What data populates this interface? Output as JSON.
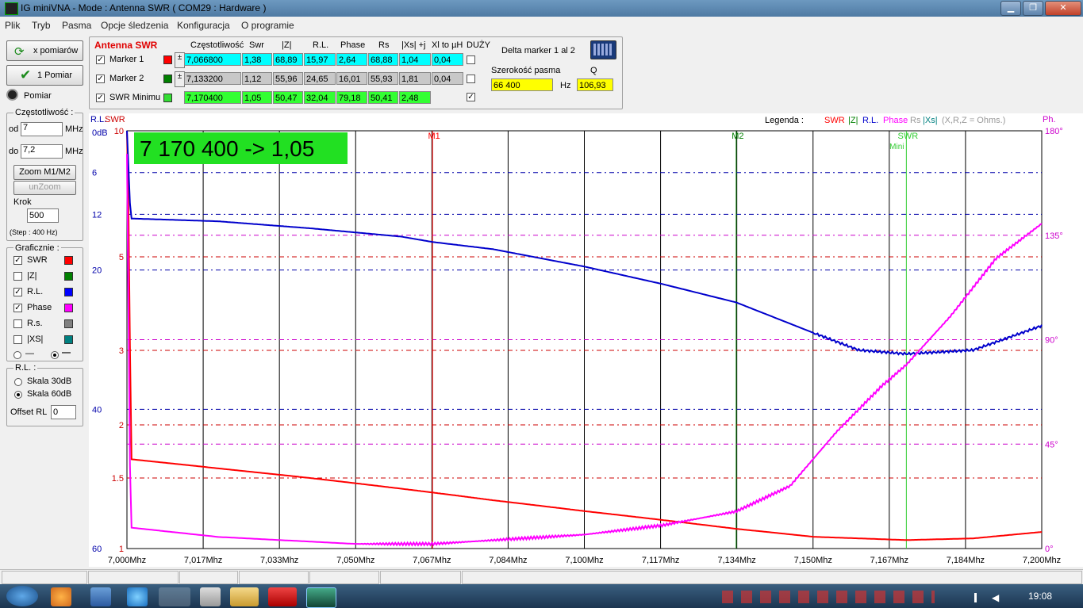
{
  "window": {
    "title": "IG miniVNA - Mode : Antenna SWR ( COM29 :  Hardware )",
    "minimize_glyph": "▁",
    "maximize_glyph": "❐",
    "close_glyph": "✕"
  },
  "menu": [
    "Plik",
    "Tryb",
    "Pasma",
    "Opcje śledzenia",
    "Konfiguracja",
    "O programie"
  ],
  "left": {
    "x_pomiarow": "x pomiarów",
    "one_pomiar": "1 Pomiar",
    "pomiar": "Pomiar",
    "freq_group": "Częstotliwość :",
    "od_label": "od",
    "od_value": "7",
    "do_label": "do",
    "do_value": "7,2",
    "mhz": "MHz",
    "zoom_btn": "Zoom M1/M2",
    "unzoom_btn": "unZoom",
    "krok_label": "Krok",
    "krok_value": "500",
    "step_note": "(Step : 400 Hz)",
    "graf_group": "Graficznie :",
    "graf_items": [
      {
        "label": "SWR",
        "checked": true,
        "color": "#ff0000"
      },
      {
        "label": "|Z|",
        "checked": false,
        "color": "#008000"
      },
      {
        "label": "R.L.",
        "checked": true,
        "color": "#0000ff"
      },
      {
        "label": "Phase",
        "checked": true,
        "color": "#ff00ff"
      },
      {
        "label": "R.s.",
        "checked": false,
        "color": "#808080"
      },
      {
        "label": "|XS|",
        "checked": false,
        "color": "#008080"
      }
    ],
    "rl_group": "R.L. :",
    "skala30": "Skala 30dB",
    "skala60": "Skala 60dB",
    "offset_label": "Offset RL",
    "offset_value": "0"
  },
  "markers": {
    "title": "Antenna SWR",
    "headers": [
      "Częstotliwość",
      "Swr",
      "|Z|",
      "R.L.",
      "Phase",
      "Rs",
      "|Xs| +j",
      "Xl to µH",
      "DUŻY"
    ],
    "rows": [
      {
        "label": "Marker 1",
        "color": "#ff0000",
        "values": [
          "7,066800",
          "1,38",
          "68,89",
          "15,97",
          "2,64",
          "68,88",
          "1,04",
          "0,04"
        ],
        "style": "cyan"
      },
      {
        "label": "Marker 2",
        "color": "#008000",
        "values": [
          "7,133200",
          "1,12",
          "55,96",
          "24,65",
          "16,01",
          "55,93",
          "1,81",
          "0,04"
        ],
        "style": "gray"
      },
      {
        "label": "SWR Minimu",
        "color": "#33dd33",
        "values": [
          "7,170400",
          "1,05",
          "50,47",
          "32,04",
          "79,18",
          "50,41",
          "2,48"
        ],
        "style": "green"
      }
    ],
    "pm": "±",
    "delta_label": "Delta marker 1 al 2",
    "bandwidth_label": "Szerokość pasma",
    "bandwidth_value": "66 400",
    "hz": "Hz",
    "q_label": "Q",
    "q_value": "106,93",
    "duzy_check": "✓"
  },
  "chart_data": {
    "type": "line",
    "readout": "7 170 400 -> 1,05",
    "left_header_rl": "R.L.",
    "left_header_swr": "SWR",
    "right_header": "Ph.",
    "legend_label": "Legenda :",
    "legend": [
      {
        "name": "SWR",
        "color": "#ff0000"
      },
      {
        "name": "|Z|",
        "color": "#008000"
      },
      {
        "name": "R.L.",
        "color": "#0000cc"
      },
      {
        "name": "Phase",
        "color": "#ff00ff"
      },
      {
        "name": "Rs",
        "color": "#999999"
      },
      {
        "name": "|Xs|",
        "color": "#008080"
      },
      {
        "name": "(X,R,Z = Ohms.)",
        "color": "#999999"
      }
    ],
    "x_ticks": [
      "7,000Mhz",
      "7,017Mhz",
      "7,033Mhz",
      "7,050Mhz",
      "7,067Mhz",
      "7,084Mhz",
      "7,100Mhz",
      "7,117Mhz",
      "7,134Mhz",
      "7,150Mhz",
      "7,167Mhz",
      "7,184Mhz",
      "7,200Mhz"
    ],
    "xlim": [
      7.0,
      7.2
    ],
    "rl_ticks": [
      {
        "v": 0,
        "t": "0dB"
      },
      {
        "v": 6,
        "t": "6"
      },
      {
        "v": 12,
        "t": "12"
      },
      {
        "v": 20,
        "t": "20"
      },
      {
        "v": 40,
        "t": "40"
      },
      {
        "v": 60,
        "t": "60"
      }
    ],
    "swr_ticks": [
      {
        "v": 10,
        "t": "10"
      },
      {
        "v": 5,
        "t": "5"
      },
      {
        "v": 3,
        "t": "3"
      },
      {
        "v": 2,
        "t": "2"
      },
      {
        "v": 1.5,
        "t": "1.5"
      },
      {
        "v": 1,
        "t": "1"
      }
    ],
    "phase_ticks": [
      {
        "v": 180,
        "t": "180°"
      },
      {
        "v": 135,
        "t": "135°"
      },
      {
        "v": 90,
        "t": "90°"
      },
      {
        "v": 45,
        "t": "45°"
      },
      {
        "v": 0,
        "t": "0°"
      }
    ],
    "markers": [
      {
        "name": "M1",
        "x": 7.0668,
        "color": "#ff0000"
      },
      {
        "name": "M2",
        "x": 7.1332,
        "color": "#008000"
      },
      {
        "name": "SWR",
        "sub": "Mini",
        "x": 7.1704,
        "color": "#33cc33"
      }
    ],
    "series": [
      {
        "name": "SWR",
        "color": "#ff0000",
        "x": [
          7.0,
          7.0008,
          7.001,
          7.02,
          7.04,
          7.0668,
          7.08,
          7.1,
          7.1332,
          7.15,
          7.1704,
          7.185,
          7.2
        ],
        "y": [
          10,
          1.7,
          1.66,
          1.58,
          1.5,
          1.38,
          1.32,
          1.24,
          1.12,
          1.07,
          1.05,
          1.06,
          1.1
        ]
      },
      {
        "name": "R.L.",
        "color": "#0000cc",
        "x": [
          7.0,
          7.0008,
          7.001,
          7.02,
          7.04,
          7.06,
          7.0668,
          7.08,
          7.1,
          7.117,
          7.1332,
          7.15,
          7.16,
          7.1704,
          7.185,
          7.2
        ],
        "y": [
          0,
          12.5,
          12.6,
          13.0,
          14.0,
          15.2,
          15.97,
          17.0,
          19.5,
          22.0,
          24.65,
          29.0,
          31.5,
          32.04,
          31.5,
          28.0
        ]
      },
      {
        "name": "Phase",
        "color": "#ff00ff",
        "x": [
          7.0,
          7.0008,
          7.001,
          7.02,
          7.05,
          7.0668,
          7.1,
          7.117,
          7.1332,
          7.145,
          7.155,
          7.165,
          7.1704,
          7.18,
          7.19,
          7.2
        ],
        "y": [
          170,
          9,
          9,
          5,
          2,
          2,
          6,
          10,
          16,
          27,
          50,
          70,
          79.18,
          100,
          125,
          140
        ]
      }
    ]
  },
  "taskbar": {
    "clock": "19:08"
  }
}
